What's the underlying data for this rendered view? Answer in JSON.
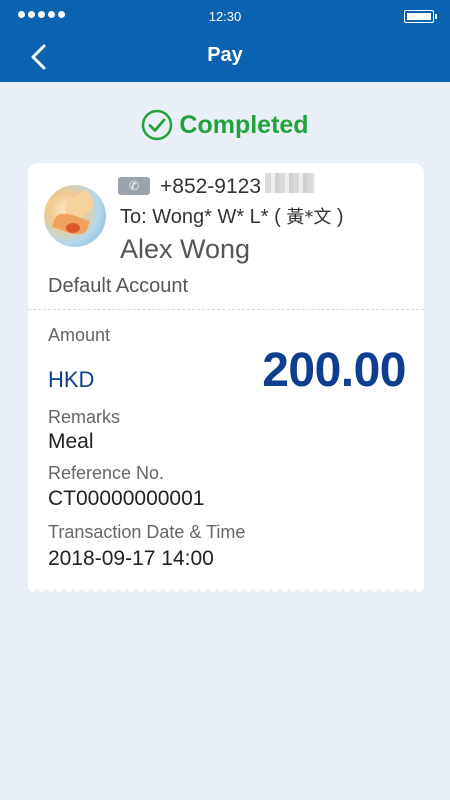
{
  "status_bar": {
    "time": "12:30"
  },
  "nav": {
    "title": "Pay",
    "back_icon": "chevron-left-icon"
  },
  "status": {
    "text": "Completed",
    "icon": "check-circle-icon",
    "color": "#22a23a"
  },
  "recipient": {
    "phone_icon": "phone-icon",
    "phone": "+852-9123",
    "to_line": "To:  Wong* W* L* ( ",
    "to_chinese": "黃*文",
    "to_close": " )",
    "name": "Alex Wong",
    "account": "Default Account"
  },
  "details": {
    "amount_label": "Amount",
    "currency": "HKD",
    "amount": "200.00",
    "remarks_label": "Remarks",
    "remarks": "Meal",
    "reference_label": "Reference No.",
    "reference": "CT00000000001",
    "datetime_label": "Transaction Date & Time",
    "datetime": "2018-09-17 14:00"
  },
  "colors": {
    "header": "#0a62b1",
    "amount": "#0e3e8e",
    "background": "#e8eff7"
  }
}
